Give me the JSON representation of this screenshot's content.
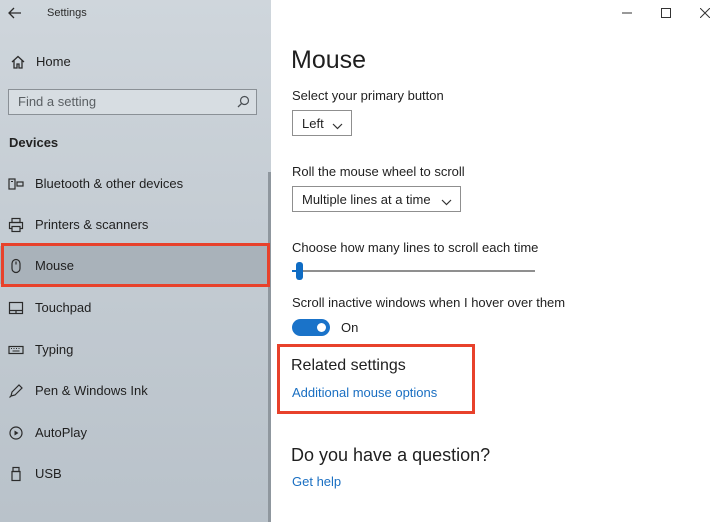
{
  "window": {
    "title": "Settings",
    "controls": [
      "minimize",
      "maximize",
      "close"
    ]
  },
  "sidebar": {
    "home_label": "Home",
    "search_placeholder": "Find a setting",
    "section_heading": "Devices",
    "items": [
      {
        "label": "Bluetooth & other devices",
        "icon": "bluetooth-icon",
        "selected": false
      },
      {
        "label": "Printers & scanners",
        "icon": "printer-icon",
        "selected": false
      },
      {
        "label": "Mouse",
        "icon": "mouse-icon",
        "selected": true
      },
      {
        "label": "Touchpad",
        "icon": "touchpad-icon",
        "selected": false
      },
      {
        "label": "Typing",
        "icon": "keyboard-icon",
        "selected": false
      },
      {
        "label": "Pen & Windows Ink",
        "icon": "pen-icon",
        "selected": false
      },
      {
        "label": "AutoPlay",
        "icon": "autoplay-icon",
        "selected": false
      },
      {
        "label": "USB",
        "icon": "usb-icon",
        "selected": false
      }
    ]
  },
  "main": {
    "title": "Mouse",
    "primary_button": {
      "label": "Select your primary button",
      "value": "Left"
    },
    "wheel_scroll": {
      "label": "Roll the mouse wheel to scroll",
      "value": "Multiple lines at a time"
    },
    "lines_to_scroll": {
      "label": "Choose how many lines to scroll each time",
      "slider_fraction": 0.03
    },
    "inactive_scroll": {
      "label": "Scroll inactive windows when I hover over them",
      "state": "On"
    },
    "related": {
      "heading": "Related settings",
      "link": "Additional mouse options"
    },
    "question": {
      "heading": "Do you have a question?",
      "link": "Get help"
    }
  },
  "colors": {
    "accent": "#1a73c9",
    "link": "#1a6fc2",
    "highlight_box": "#e8412b"
  }
}
